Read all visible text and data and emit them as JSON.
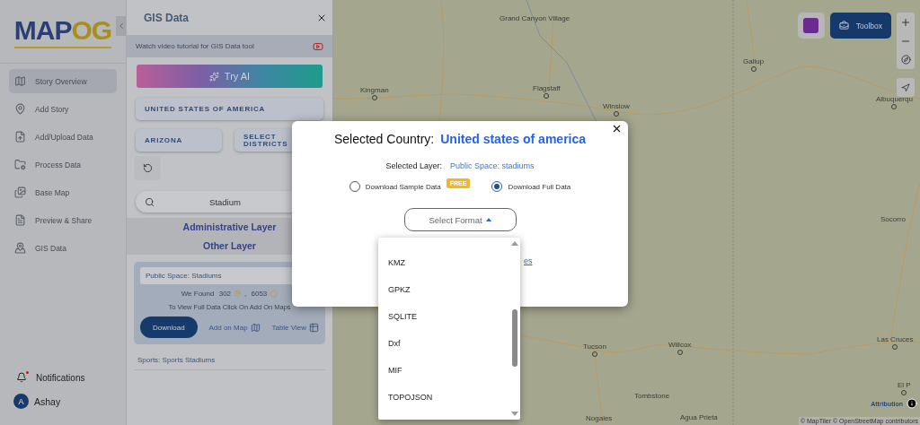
{
  "sidebar": {
    "logo": {
      "primary": "MAP",
      "accent": "OG"
    },
    "items": [
      {
        "label": "Story Overview",
        "selected": true
      },
      {
        "label": "Add Story",
        "selected": false
      },
      {
        "label": "Add/Upload Data",
        "selected": false
      },
      {
        "label": "Process Data",
        "selected": false
      },
      {
        "label": "Base Map",
        "selected": false
      },
      {
        "label": "Preview & Share",
        "selected": false
      },
      {
        "label": "GIS Data",
        "selected": false
      }
    ],
    "notifications": {
      "label": "Notifications",
      "unread": true
    },
    "user": {
      "initial": "A",
      "name": "Ashay"
    }
  },
  "panel": {
    "title": "GIS Data",
    "tutorial": "Watch video tutorial for GIS Data tool",
    "try_ai": "Try AI",
    "country": "UNITED STATES OF AMERICA",
    "state": "ARIZONA",
    "districts": "SELECT DISTRICTS",
    "search": {
      "value": "Stadium"
    },
    "layer_tabs": [
      "Administrative Layer",
      "Other Layer"
    ],
    "card": {
      "title": "Public Space: Stadiums",
      "found_label": "We Found",
      "points": "302",
      "separator": ",",
      "polygons": "6053",
      "hint": "To View Full Data Click On Add On Maps",
      "download": "Download",
      "add_on_map": "Add on Map",
      "table_view": "Table View"
    },
    "next_item": "Sports: Sports Stadiums"
  },
  "map": {
    "labels": [
      "Grand Canyon Village",
      "Kingman",
      "Flagstaff",
      "Winslow",
      "Gallup",
      "Albuquerqu",
      "Socorro",
      "Tucson",
      "Willcox",
      "Las Cruces",
      "Tombstone",
      "El P",
      "Nogales",
      "Agua Prieta"
    ],
    "toolbox": "Toolbox",
    "attribution": "Attribution",
    "copyright": "© MapTiler © OpenStreetMap contributors"
  },
  "modal": {
    "country_label": "Selected Country:",
    "country": "United states of america",
    "layer_label": "Selected Layer:",
    "layer": "Public Space: stadiums",
    "options": [
      {
        "label": "Download Sample Data",
        "badge": "FREE",
        "selected": false
      },
      {
        "label": "Download Full Data",
        "selected": true
      }
    ],
    "format_placeholder": "Select Format",
    "link_fragment": "es",
    "formats": [
      "KMZ",
      "GPKZ",
      "SQLITE",
      "Dxf",
      "MIF",
      "TOPOJSON"
    ]
  }
}
